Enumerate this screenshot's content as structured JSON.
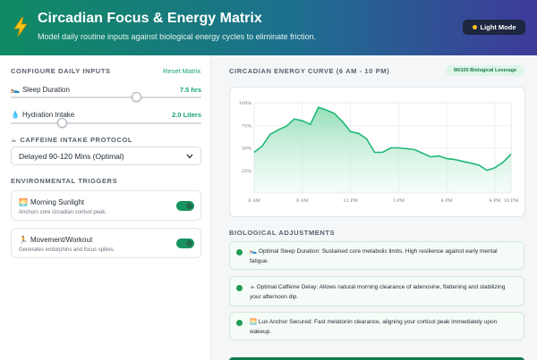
{
  "header": {
    "title": "Circadian Focus & Energy Matrix",
    "subtitle": "Model daily routine inputs against biological energy cycles to eliminate friction.",
    "mode_label": "Light Mode"
  },
  "inputs": {
    "section_label": "CONFIGURE DAILY INPUTS",
    "reset_label": "Reset Matrix",
    "sleep": {
      "icon": "🛌",
      "label": "Sleep Duration",
      "value": "7.5 hrs",
      "fraction": 0.66
    },
    "hydration": {
      "icon": "💧",
      "label": "Hydration Intake",
      "value": "2.0 Liters",
      "fraction": 0.27
    },
    "caffeine": {
      "icon": "☕",
      "label": "CAFFEINE INTAKE PROTOCOL",
      "selected": "Delayed 90-120 Mins (Optimal)"
    }
  },
  "environment": {
    "section_label": "ENVIRONMENTAL TRIGGERS",
    "triggers": [
      {
        "icon": "🌅",
        "title": "Morning Sunlight",
        "desc": "Anchors core circadian cortisol peak.",
        "on": true
      },
      {
        "icon": "🏃",
        "title": "Movement/Workout",
        "desc": "Generates endorphins and focus spikes.",
        "on": true
      }
    ]
  },
  "chart_section": {
    "title": "CIRCADIAN ENERGY CURVE (6 AM - 10 PM)",
    "badge": "90/100 Biological Leverage"
  },
  "chart_data": {
    "type": "area",
    "x": [
      6,
      6.5,
      7,
      7.5,
      8,
      8.5,
      9,
      9.5,
      10,
      10.5,
      11,
      11.5,
      12,
      12.5,
      13,
      13.5,
      14,
      14.5,
      15,
      15.5,
      16,
      16.5,
      17,
      17.5,
      18,
      18.5,
      19,
      19.5,
      20,
      20.5,
      21,
      21.5,
      22
    ],
    "y": [
      45,
      52,
      65,
      70,
      74,
      82,
      80,
      76,
      95,
      92,
      88,
      79,
      68,
      66,
      60,
      45,
      45,
      50,
      50,
      49,
      48,
      44,
      40,
      41,
      38,
      37,
      35,
      33,
      31,
      25,
      28,
      34,
      43
    ],
    "x_ticks": [
      "6 AM",
      "9 AM",
      "12 PM",
      "3 PM",
      "6 PM",
      "9 PM",
      "10 PM"
    ],
    "x_tick_values": [
      6,
      9,
      12,
      15,
      18,
      21,
      22
    ],
    "y_ticks": [
      "100%",
      "75%",
      "50%",
      "25%"
    ],
    "y_tick_values": [
      100,
      75,
      50,
      25
    ],
    "xlim": [
      6,
      22
    ],
    "ylim": [
      0,
      100
    ],
    "grid": true,
    "color": "#1fb877"
  },
  "adjustments": {
    "section_label": "BIOLOGICAL ADJUSTMENTS",
    "items": [
      {
        "text": "🛌 Optimal Sleep Duration: Sustained core metabolic limits. High resilience against early mental fatigue."
      },
      {
        "text": "☕ Optimal Caffeine Delay: Allows natural morning clearance of adenosine, flattening and stabilizing your afternoon dip."
      },
      {
        "text": "🌅 Lux Anchor Secured: Fast melatonin clearance, aligning your cortisol peak immediately upon wakeup."
      }
    ]
  },
  "colors": {
    "accent": "#16a36a",
    "toggle": "#17935f"
  }
}
